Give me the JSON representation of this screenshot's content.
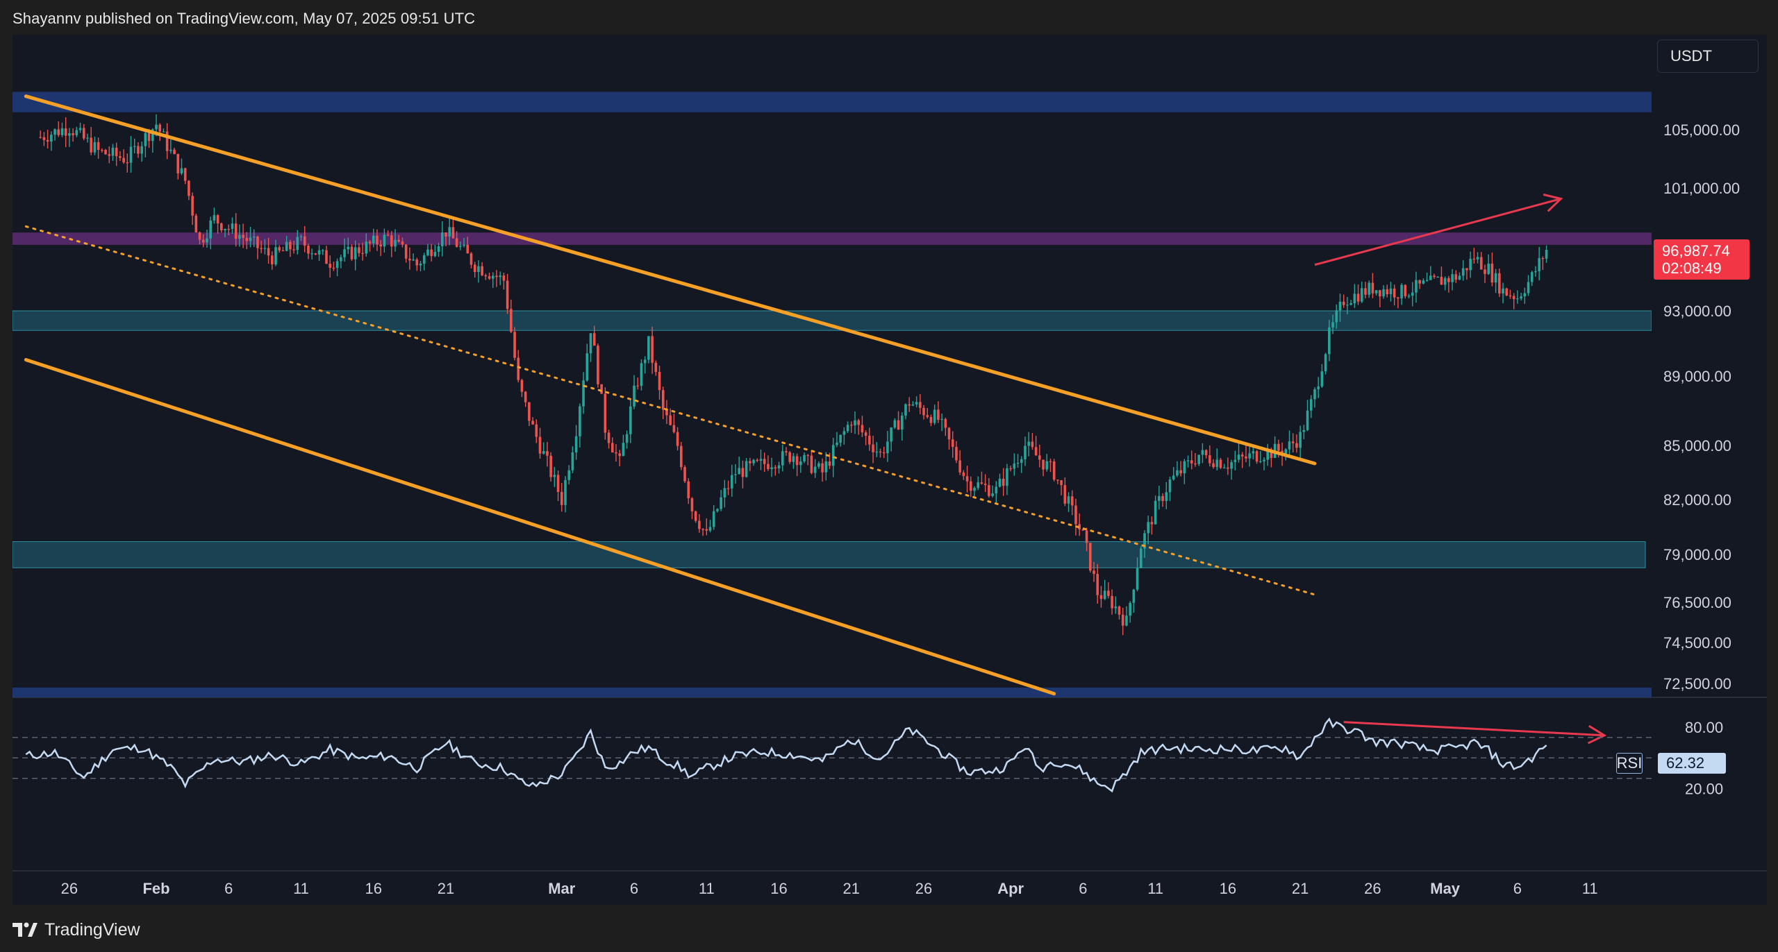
{
  "header": {
    "text": "Shayannv published on TradingView.com, May 07, 2025 09:51 UTC"
  },
  "footer": {
    "brand": "TradingView"
  },
  "toolbar": {
    "currency": "USDT"
  },
  "price_badge": {
    "price": "96,987.74",
    "countdown": "02:08:49"
  },
  "rsi_badge": {
    "name": "RSI",
    "value": "62.32"
  },
  "colors": {
    "background": "#141823",
    "up_candle": "#26a69a",
    "down_candle": "#ef5350",
    "channel_line": "#f7a027",
    "arrow": "#e8394f",
    "rsi_line": "#c4d9f2",
    "zone_blue": "#1e3a78",
    "zone_teal": "#1b4a5c",
    "zone_purple": "#5a2a6e"
  },
  "chart_data": [
    {
      "type": "candlestick",
      "title": "",
      "y_axis": {
        "ticks": [
          {
            "label": "105,000.00",
            "value": 105000
          },
          {
            "label": "101,000.00",
            "value": 101000
          },
          {
            "label": "93,000.00",
            "value": 93000
          },
          {
            "label": "89,000.00",
            "value": 89000
          },
          {
            "label": "85,000.00",
            "value": 85000
          },
          {
            "label": "82,000.00",
            "value": 82000
          },
          {
            "label": "79,000.00",
            "value": 79000
          },
          {
            "label": "76,500.00",
            "value": 76500
          },
          {
            "label": "74,500.00",
            "value": 74500
          },
          {
            "label": "72,500.00",
            "value": 72500
          }
        ]
      },
      "x_axis": {
        "ticks": [
          {
            "label": "26",
            "day": -6
          },
          {
            "label": "Feb",
            "day": 0
          },
          {
            "label": "6",
            "day": 5
          },
          {
            "label": "11",
            "day": 10
          },
          {
            "label": "16",
            "day": 15
          },
          {
            "label": "21",
            "day": 20
          },
          {
            "label": "Mar",
            "day": 28
          },
          {
            "label": "6",
            "day": 33
          },
          {
            "label": "11",
            "day": 38
          },
          {
            "label": "16",
            "day": 43
          },
          {
            "label": "21",
            "day": 48
          },
          {
            "label": "26",
            "day": 53
          },
          {
            "label": "Apr",
            "day": 59
          },
          {
            "label": "6",
            "day": 64
          },
          {
            "label": "11",
            "day": 69
          },
          {
            "label": "16",
            "day": 74
          },
          {
            "label": "21",
            "day": 79
          },
          {
            "label": "26",
            "day": 84
          },
          {
            "label": "May",
            "day": 89
          },
          {
            "label": "6",
            "day": 94
          },
          {
            "label": "11",
            "day": 99
          }
        ]
      },
      "price_path": [
        {
          "day": -8,
          "price": 104500
        },
        {
          "day": -6,
          "price": 105200
        },
        {
          "day": -4,
          "price": 103500
        },
        {
          "day": -2,
          "price": 103000
        },
        {
          "day": 0,
          "price": 105400
        },
        {
          "day": 2,
          "price": 101500
        },
        {
          "day": 3,
          "price": 97500
        },
        {
          "day": 4,
          "price": 99000
        },
        {
          "day": 6,
          "price": 97800
        },
        {
          "day": 8,
          "price": 96500
        },
        {
          "day": 10,
          "price": 97500
        },
        {
          "day": 12,
          "price": 96200
        },
        {
          "day": 14,
          "price": 97000
        },
        {
          "day": 16,
          "price": 97800
        },
        {
          "day": 18,
          "price": 96000
        },
        {
          "day": 20,
          "price": 98200
        },
        {
          "day": 22,
          "price": 96000
        },
        {
          "day": 24,
          "price": 95000
        },
        {
          "day": 25,
          "price": 88500
        },
        {
          "day": 26,
          "price": 86000
        },
        {
          "day": 27,
          "price": 84000
        },
        {
          "day": 28,
          "price": 82000
        },
        {
          "day": 29,
          "price": 86000
        },
        {
          "day": 30,
          "price": 92000
        },
        {
          "day": 31,
          "price": 86000
        },
        {
          "day": 32,
          "price": 84000
        },
        {
          "day": 33,
          "price": 88000
        },
        {
          "day": 34,
          "price": 91000
        },
        {
          "day": 35,
          "price": 87000
        },
        {
          "day": 36,
          "price": 85000
        },
        {
          "day": 37,
          "price": 81500
        },
        {
          "day": 38,
          "price": 80000
        },
        {
          "day": 39,
          "price": 82000
        },
        {
          "day": 40,
          "price": 83500
        },
        {
          "day": 42,
          "price": 84000
        },
        {
          "day": 44,
          "price": 84500
        },
        {
          "day": 46,
          "price": 83500
        },
        {
          "day": 48,
          "price": 86500
        },
        {
          "day": 50,
          "price": 84500
        },
        {
          "day": 52,
          "price": 87500
        },
        {
          "day": 54,
          "price": 86500
        },
        {
          "day": 56,
          "price": 83000
        },
        {
          "day": 58,
          "price": 82500
        },
        {
          "day": 60,
          "price": 85000
        },
        {
          "day": 62,
          "price": 83500
        },
        {
          "day": 64,
          "price": 80000
        },
        {
          "day": 65,
          "price": 77000
        },
        {
          "day": 66,
          "price": 76500
        },
        {
          "day": 67,
          "price": 75500
        },
        {
          "day": 68,
          "price": 79500
        },
        {
          "day": 69,
          "price": 81500
        },
        {
          "day": 70,
          "price": 83000
        },
        {
          "day": 72,
          "price": 84500
        },
        {
          "day": 74,
          "price": 84000
        },
        {
          "day": 76,
          "price": 84500
        },
        {
          "day": 78,
          "price": 84800
        },
        {
          "day": 79,
          "price": 85500
        },
        {
          "day": 80,
          "price": 88000
        },
        {
          "day": 81,
          "price": 91500
        },
        {
          "day": 82,
          "price": 93700
        },
        {
          "day": 84,
          "price": 94500
        },
        {
          "day": 86,
          "price": 94200
        },
        {
          "day": 88,
          "price": 94800
        },
        {
          "day": 90,
          "price": 95300
        },
        {
          "day": 91,
          "price": 96500
        },
        {
          "day": 92,
          "price": 95700
        },
        {
          "day": 93,
          "price": 94300
        },
        {
          "day": 94,
          "price": 93900
        },
        {
          "day": 95,
          "price": 95200
        },
        {
          "day": 96,
          "price": 96988
        }
      ],
      "zones": [
        {
          "name": "upper-supply",
          "from": 106200,
          "to": 107600,
          "color": "#1e3a78"
        },
        {
          "name": "resistance",
          "from": 97300,
          "to": 98100,
          "color": "#5a2a6e"
        },
        {
          "name": "support-93k",
          "from": 91800,
          "to": 93000,
          "color": "#1b4a5c"
        },
        {
          "name": "support-79k",
          "from": 78300,
          "to": 79700,
          "color": "#1b4a5c"
        },
        {
          "name": "lower-demand",
          "from": 71800,
          "to": 72300,
          "color": "#1e3a78"
        }
      ],
      "trendlines": [
        {
          "name": "channel-upper",
          "style": "solid",
          "from": {
            "day": -9,
            "price": 107300
          },
          "to": {
            "day": 80,
            "price": 84000
          }
        },
        {
          "name": "channel-lower",
          "style": "solid",
          "from": {
            "day": -9,
            "price": 90000
          },
          "to": {
            "day": 62,
            "price": 72000
          }
        },
        {
          "name": "channel-mid",
          "style": "dotted",
          "from": {
            "day": -9,
            "price": 98500
          },
          "to": {
            "day": 80,
            "price": 76900
          }
        },
        {
          "name": "price-arrow",
          "style": "arrow",
          "from": {
            "day": 80,
            "price": 96000
          },
          "to": {
            "day": 97,
            "price": 100300
          }
        }
      ]
    },
    {
      "type": "line",
      "title": "",
      "series": [
        {
          "name": "RSI",
          "value_last": 62.32
        }
      ],
      "y_axis": {
        "ticks": [
          80,
          40,
          20
        ],
        "ylim": [
          10,
          90
        ],
        "reference_lines": [
          70,
          50,
          30
        ]
      },
      "rsi_path": [
        {
          "day": -9,
          "v": 52
        },
        {
          "day": -7,
          "v": 55
        },
        {
          "day": -5,
          "v": 31
        },
        {
          "day": -3,
          "v": 58
        },
        {
          "day": -1,
          "v": 60
        },
        {
          "day": 1,
          "v": 41
        },
        {
          "day": 2,
          "v": 24
        },
        {
          "day": 4,
          "v": 49
        },
        {
          "day": 6,
          "v": 46
        },
        {
          "day": 8,
          "v": 53
        },
        {
          "day": 10,
          "v": 44
        },
        {
          "day": 12,
          "v": 58
        },
        {
          "day": 14,
          "v": 49
        },
        {
          "day": 16,
          "v": 52
        },
        {
          "day": 18,
          "v": 40
        },
        {
          "day": 20,
          "v": 65
        },
        {
          "day": 22,
          "v": 45
        },
        {
          "day": 24,
          "v": 40
        },
        {
          "day": 25,
          "v": 28
        },
        {
          "day": 26,
          "v": 22
        },
        {
          "day": 27,
          "v": 28
        },
        {
          "day": 28,
          "v": 34
        },
        {
          "day": 29,
          "v": 52
        },
        {
          "day": 30,
          "v": 75
        },
        {
          "day": 31,
          "v": 41
        },
        {
          "day": 32,
          "v": 45
        },
        {
          "day": 33,
          "v": 56
        },
        {
          "day": 34,
          "v": 60
        },
        {
          "day": 35,
          "v": 49
        },
        {
          "day": 36,
          "v": 42
        },
        {
          "day": 37,
          "v": 32
        },
        {
          "day": 38,
          "v": 40
        },
        {
          "day": 40,
          "v": 52
        },
        {
          "day": 42,
          "v": 56
        },
        {
          "day": 44,
          "v": 53
        },
        {
          "day": 46,
          "v": 47
        },
        {
          "day": 48,
          "v": 68
        },
        {
          "day": 50,
          "v": 49
        },
        {
          "day": 52,
          "v": 78
        },
        {
          "day": 54,
          "v": 58
        },
        {
          "day": 56,
          "v": 36
        },
        {
          "day": 58,
          "v": 38
        },
        {
          "day": 59,
          "v": 45
        },
        {
          "day": 60,
          "v": 62
        },
        {
          "day": 61,
          "v": 39
        },
        {
          "day": 62,
          "v": 47
        },
        {
          "day": 63,
          "v": 44
        },
        {
          "day": 64,
          "v": 37
        },
        {
          "day": 65,
          "v": 25
        },
        {
          "day": 66,
          "v": 21
        },
        {
          "day": 67,
          "v": 36
        },
        {
          "day": 68,
          "v": 55
        },
        {
          "day": 69,
          "v": 58
        },
        {
          "day": 70,
          "v": 60
        },
        {
          "day": 72,
          "v": 58
        },
        {
          "day": 74,
          "v": 59
        },
        {
          "day": 76,
          "v": 57
        },
        {
          "day": 78,
          "v": 60
        },
        {
          "day": 79,
          "v": 50
        },
        {
          "day": 80,
          "v": 70
        },
        {
          "day": 81,
          "v": 84
        },
        {
          "day": 82,
          "v": 79
        },
        {
          "day": 83,
          "v": 75
        },
        {
          "day": 84,
          "v": 66
        },
        {
          "day": 86,
          "v": 64
        },
        {
          "day": 88,
          "v": 57
        },
        {
          "day": 90,
          "v": 60
        },
        {
          "day": 91,
          "v": 65
        },
        {
          "day": 92,
          "v": 57
        },
        {
          "day": 93,
          "v": 44
        },
        {
          "day": 94,
          "v": 41
        },
        {
          "day": 95,
          "v": 50
        },
        {
          "day": 96,
          "v": 62.32
        }
      ],
      "arrow": {
        "from": {
          "day": 82,
          "v": 85
        },
        "to": {
          "day": 100,
          "v": 72
        }
      }
    }
  ]
}
